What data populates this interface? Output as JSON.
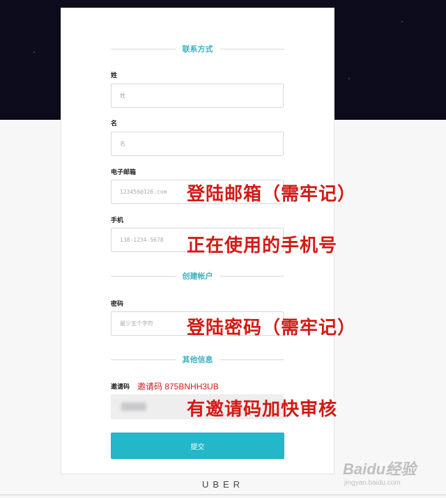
{
  "sections": {
    "contact": "联系方式",
    "account": "创建帐户",
    "other": "其他信息"
  },
  "fields": {
    "surname": {
      "label": "姓",
      "placeholder": "姓"
    },
    "given_name": {
      "label": "名",
      "placeholder": "名"
    },
    "email": {
      "label": "电子邮箱",
      "placeholder": "123456@126.com"
    },
    "phone": {
      "label": "手机",
      "placeholder": "138-1234-5678"
    },
    "password": {
      "label": "密码",
      "placeholder": "最少五个字符"
    },
    "invite": {
      "label": "邀请码"
    }
  },
  "annotations": {
    "email": "登陆邮箱（需牢记）",
    "phone": "正在使用的手机号",
    "password": "登陆密码（需牢记）",
    "invite_code": "邀请码 875BNHH3UB",
    "invite": "有邀请码加快审核"
  },
  "submit_label": "提交",
  "footer_logo": "UBER",
  "watermark": {
    "text": "Baidu经验",
    "sub": "jingyan.baidu.com"
  },
  "colors": {
    "accent": "#24b6c9",
    "section_title": "#3fb1c2",
    "annotation": "#d21a14",
    "header_bg": "#0d0c1c"
  }
}
